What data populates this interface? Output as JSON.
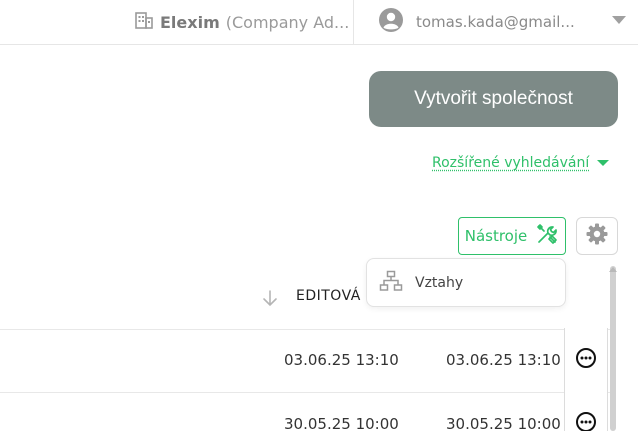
{
  "header": {
    "company_name": "Elexim",
    "company_role": "(Company Ad...",
    "user_email": "tomas.kada@gmail..."
  },
  "actions": {
    "create_company": "Vytvořit společnost",
    "advanced_search": "Rozšířené vyhledávání",
    "tools": "Nástroje"
  },
  "dropdown": {
    "items": [
      {
        "label": "Vztahy",
        "icon": "hierarchy-icon"
      }
    ]
  },
  "table": {
    "columns": [
      "EDITOVÁNO"
    ],
    "visible_column_header": "EDITOVÁ",
    "rows": [
      {
        "created": "03.06.25 13:10",
        "edited": "03.06.25 13:10"
      },
      {
        "created": "30.05.25 10:00",
        "edited": "30.05.25 10:00"
      }
    ]
  },
  "colors": {
    "accent_green": "#2fc06a",
    "button_gray": "#7d8a87"
  }
}
